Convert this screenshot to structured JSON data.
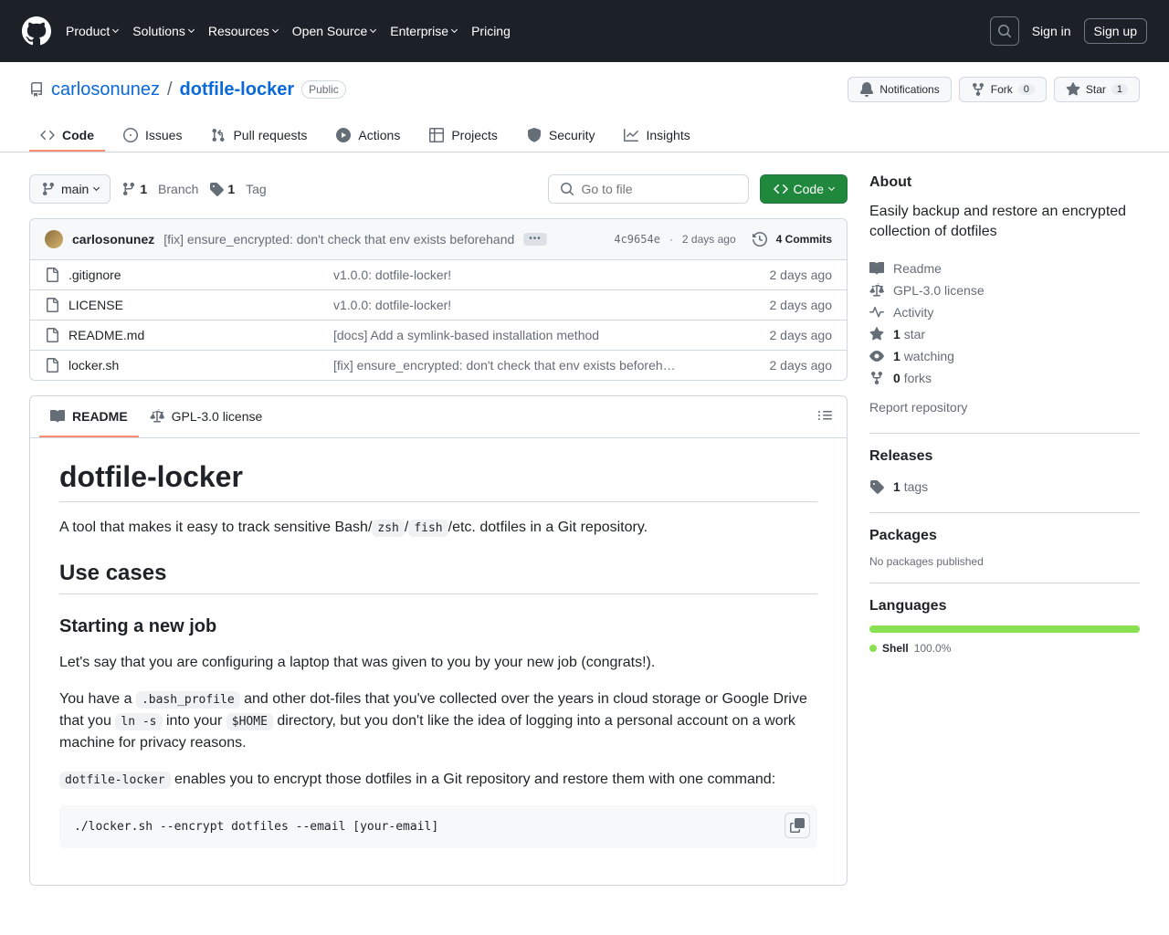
{
  "nav": {
    "items": [
      "Product",
      "Solutions",
      "Resources",
      "Open Source",
      "Enterprise",
      "Pricing"
    ],
    "signin": "Sign in",
    "signup": "Sign up"
  },
  "repo": {
    "owner": "carlosonunez",
    "sep": "/",
    "name": "dotfile-locker",
    "visibility": "Public",
    "actions": {
      "notifications": "Notifications",
      "fork": "Fork",
      "fork_count": "0",
      "star": "Star",
      "star_count": "1"
    },
    "tabs": [
      "Code",
      "Issues",
      "Pull requests",
      "Actions",
      "Projects",
      "Security",
      "Insights"
    ]
  },
  "toolbar": {
    "branch": "main",
    "branches_count": "1",
    "branches_label": "Branch",
    "tags_count": "1",
    "tags_label": "Tag",
    "goto_placeholder": "Go to file",
    "code": "Code"
  },
  "commit": {
    "author": "carlosonunez",
    "message": "[fix] ensure_encrypted: don't check that env exists beforehand",
    "sha": "4c9654e",
    "date": "2 days ago",
    "commits_count": "4 Commits"
  },
  "files": [
    {
      "name": ".gitignore",
      "msg": "v1.0.0: dotfile-locker!",
      "date": "2 days ago"
    },
    {
      "name": "LICENSE",
      "msg": "v1.0.0: dotfile-locker!",
      "date": "2 days ago"
    },
    {
      "name": "README.md",
      "msg": "[docs] Add a symlink-based installation method",
      "date": "2 days ago"
    },
    {
      "name": "locker.sh",
      "msg": "[fix] ensure_encrypted: don't check that env exists beforeh…",
      "date": "2 days ago"
    }
  ],
  "readme_tabs": {
    "readme": "README",
    "license": "GPL-3.0 license"
  },
  "readme": {
    "title": "dotfile-locker",
    "intro_1": "A tool that makes it easy to track sensitive Bash/",
    "intro_zsh": "zsh",
    "intro_slash": "/",
    "intro_fish": "fish",
    "intro_2": "/etc. dotfiles in a Git repository.",
    "h2": "Use cases",
    "h3": "Starting a new job",
    "p1": "Let's say that you are configuring a laptop that was given to you by your new job (congrats!).",
    "p2a": "You have a ",
    "p2_code1": ".bash_profile",
    "p2b": " and other dot-files that you've collected over the years in cloud storage or Google Drive that you ",
    "p2_code2": "ln -s",
    "p2c": " into your ",
    "p2_code3": "$HOME",
    "p2d": " directory, but you don't like the idea of logging into a personal account on a work machine for privacy reasons.",
    "p3_code": "dotfile-locker",
    "p3": " enables you to encrypt those dotfiles in a Git repository and restore them with one command:",
    "codeblock": "./locker.sh --encrypt dotfiles --email [your-email]"
  },
  "side": {
    "about": "About",
    "desc": "Easily backup and restore an encrypted collection of dotfiles",
    "readme": "Readme",
    "license": "GPL-3.0 license",
    "activity": "Activity",
    "stars_n": "1",
    "stars": "star",
    "watch_n": "1",
    "watch": "watching",
    "forks_n": "0",
    "forks": "forks",
    "report": "Report repository",
    "releases": "Releases",
    "tags_n": "1",
    "tags": "tags",
    "packages": "Packages",
    "packages_none": "No packages published",
    "languages": "Languages",
    "lang_name": "Shell",
    "lang_pct": "100.0%"
  }
}
